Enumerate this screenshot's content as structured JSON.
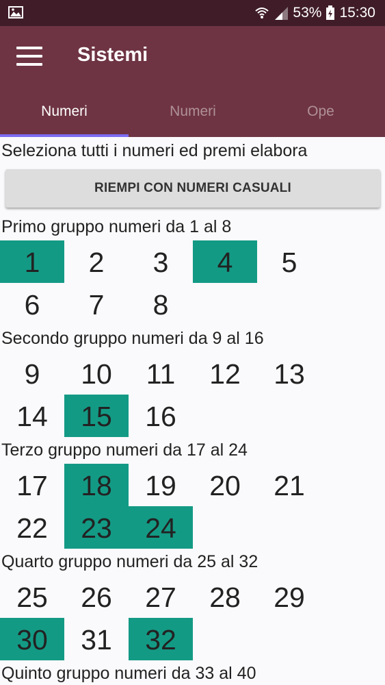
{
  "status_bar": {
    "battery": "53%",
    "time": "15:30",
    "icons": [
      "gallery-icon",
      "wifi-icon",
      "signal-icon",
      "battery-icon"
    ]
  },
  "app_bar": {
    "title": "Sistemi",
    "menu_icon": "menu-icon"
  },
  "tabs": [
    {
      "label": "Numeri",
      "active": true
    },
    {
      "label": "Numeri",
      "active": false
    },
    {
      "label": "Ope",
      "active": false
    }
  ],
  "content": {
    "instructions": "Seleziona tutti i numeri ed premi elabora",
    "random_button_label": "RIEMPI CON NUMERI CASUALI",
    "groups": [
      {
        "title": "Primo gruppo numeri da 1 al 8",
        "numbers": [
          "1",
          "2",
          "3",
          "4",
          "5",
          "6",
          "7",
          "8"
        ],
        "selected": [
          "1",
          "4"
        ]
      },
      {
        "title": "Secondo gruppo numeri da 9 al 16",
        "numbers": [
          "9",
          "10",
          "11",
          "12",
          "13",
          "14",
          "15",
          "16"
        ],
        "selected": [
          "15"
        ]
      },
      {
        "title": "Terzo gruppo numeri da 17 al 24",
        "numbers": [
          "17",
          "18",
          "19",
          "20",
          "21",
          "22",
          "23",
          "24"
        ],
        "selected": [
          "18",
          "23",
          "24"
        ]
      },
      {
        "title": "Quarto gruppo numeri da 25 al 32",
        "numbers": [
          "25",
          "26",
          "27",
          "28",
          "29",
          "30",
          "31",
          "32"
        ],
        "selected": [
          "30",
          "32"
        ]
      },
      {
        "title": "Quinto gruppo numeri da 33 al 40",
        "numbers": [],
        "selected": []
      }
    ]
  },
  "colors": {
    "status_bar": "#401c29",
    "app_bar": "#6e3443",
    "tab_indicator": "#7b6cf0",
    "selected_number": "#139a85",
    "background": "#faf9fb"
  }
}
